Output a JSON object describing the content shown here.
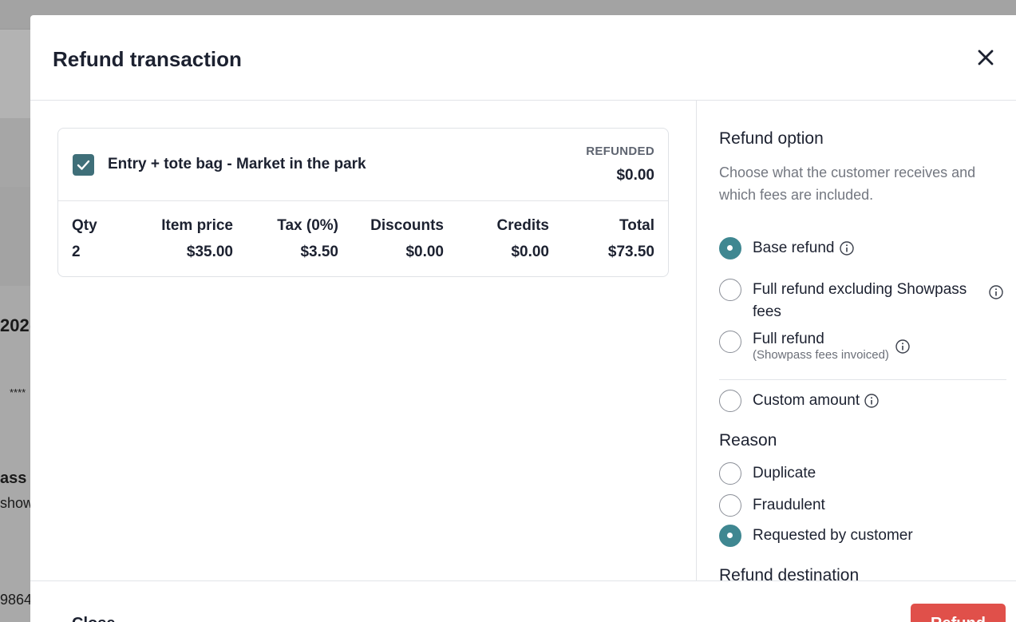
{
  "background": {
    "year_fragment": "202(",
    "masked_fragment": "****",
    "pass_fragment": "ass",
    "show_fragment": "show",
    "number_fragment": "9864"
  },
  "modal": {
    "title": "Refund transaction",
    "close_icon": "close-icon"
  },
  "item": {
    "checked": true,
    "name": "Entry + tote bag - Market in the park",
    "refunded_label": "REFUNDED",
    "refunded_value": "$0.00",
    "columns": [
      {
        "header": "Qty",
        "value": "2"
      },
      {
        "header": "Item price",
        "value": "$35.00"
      },
      {
        "header": "Tax (0%)",
        "value": "$3.50"
      },
      {
        "header": "Discounts",
        "value": "$0.00"
      },
      {
        "header": "Credits",
        "value": "$0.00"
      },
      {
        "header": "Total",
        "value": "$73.50"
      }
    ]
  },
  "refund_option": {
    "title": "Refund option",
    "description": "Choose what the customer receives and which fees are included.",
    "options": [
      {
        "label": "Base refund",
        "checked": true
      },
      {
        "label": "Full refund excluding Showpass fees",
        "checked": false
      },
      {
        "label": "Full refund",
        "sublabel": "(Showpass fees invoiced)",
        "checked": false
      },
      {
        "label": "Custom amount",
        "checked": false
      }
    ]
  },
  "reason": {
    "title": "Reason",
    "options": [
      {
        "label": "Duplicate",
        "checked": false
      },
      {
        "label": "Fraudulent",
        "checked": false
      },
      {
        "label": "Requested by customer",
        "checked": true
      }
    ]
  },
  "refund_destination": {
    "title": "Refund destination"
  },
  "footer": {
    "cancel_label": "Close",
    "refund_label": "Refund"
  },
  "colors": {
    "accent": "#3f8791",
    "checkbox": "#3f6f79",
    "refund_button": "#e0504a"
  }
}
